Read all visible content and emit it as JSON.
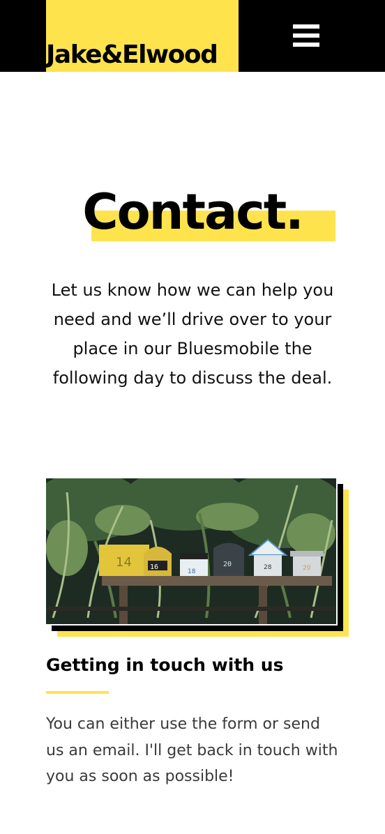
{
  "header": {
    "logo_text": "Jake&Elwood",
    "menu_icon": "hamburger-menu-icon"
  },
  "hero": {
    "title": "Contact.",
    "text": "Let us know how we can help you need and we’ll drive over to your place in our Bluesmobile the following day to discuss the deal."
  },
  "photo": {
    "mailbox_numbers": [
      "14",
      "16",
      "18",
      "20",
      "28",
      "20"
    ]
  },
  "section": {
    "heading": "Getting in touch with us",
    "text": "You can either use the form or send us an email. I'll get back in touch with you as soon as possible!"
  },
  "colors": {
    "accent": "#FFE34D",
    "header_bg": "#000000",
    "text": "#111111",
    "body_text": "#3a3a3a"
  }
}
